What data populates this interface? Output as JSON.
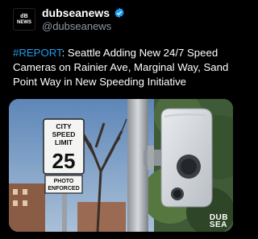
{
  "account": {
    "avatar_mark": "dB",
    "avatar_label": "NEWS",
    "name": "dubseanews",
    "handle": "@dubseanews",
    "verified_icon": "verified-badge-icon"
  },
  "tweet": {
    "hashtag": "#REPORT",
    "text": ": Seattle Adding New 24/7 Speed Cameras on Rainier Ave, Marginal Way, Sand Point Way in New Speeding Initiative"
  },
  "media": {
    "sign": {
      "line1": "CITY",
      "line2": "SPEED",
      "line3": "LIMIT",
      "number": "25",
      "plate1": "PHOTO",
      "plate2": "ENFORCED"
    },
    "watermark_line1": "DUB",
    "watermark_line2": "SEA"
  },
  "colors": {
    "background": "#000000",
    "hashtag": "#1d9bf0",
    "verified": "#1d9bf0",
    "handle": "#8b98a5"
  }
}
